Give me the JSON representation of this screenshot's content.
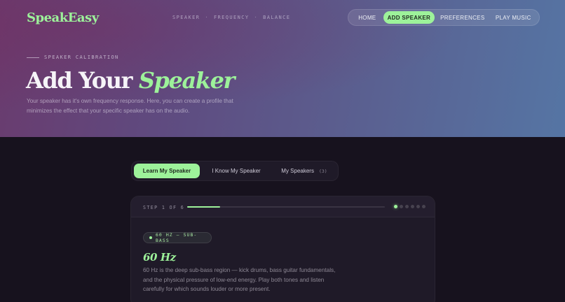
{
  "brand": {
    "logo": "SpeakEasy"
  },
  "header": {
    "crumbs": [
      "SPEAKER",
      "FREQUENCY",
      "BALANCE"
    ],
    "separator": "·",
    "nav": [
      {
        "label": "HOME",
        "active": false
      },
      {
        "label": "ADD SPEAKER",
        "active": true
      },
      {
        "label": "PREFERENCES",
        "active": false
      },
      {
        "label": "PLAY MUSIC",
        "active": false
      }
    ]
  },
  "hero": {
    "eyebrow": "SPEAKER CALIBRATION",
    "title_plain": "Add Your",
    "title_accent": "Speaker",
    "description": "Your speaker has it's own frequency response. Here, you can create a profile that minimizes the effect that your specific speaker has on the audio."
  },
  "tabs": [
    {
      "label": "Learn My Speaker",
      "active": true
    },
    {
      "label": "I Know My Speaker",
      "active": false
    },
    {
      "label": "My Speakers",
      "count": "(3)",
      "active": false
    }
  ],
  "step": {
    "label": "STEP 1 OF 6",
    "current": 1,
    "total": 6,
    "progress_fraction": 0.167
  },
  "frequency": {
    "badge": "60 HZ — SUB-BASS",
    "title": "60 Hz",
    "description": "60 Hz is the deep sub-bass region — kick drums, bass guitar fundamentals, and the physical pressure of low-end energy. Play both tones and listen carefully for which sounds louder or more present."
  },
  "colors": {
    "accent": "#9df29a",
    "background": "#17121e",
    "card": "#1f1a28"
  }
}
